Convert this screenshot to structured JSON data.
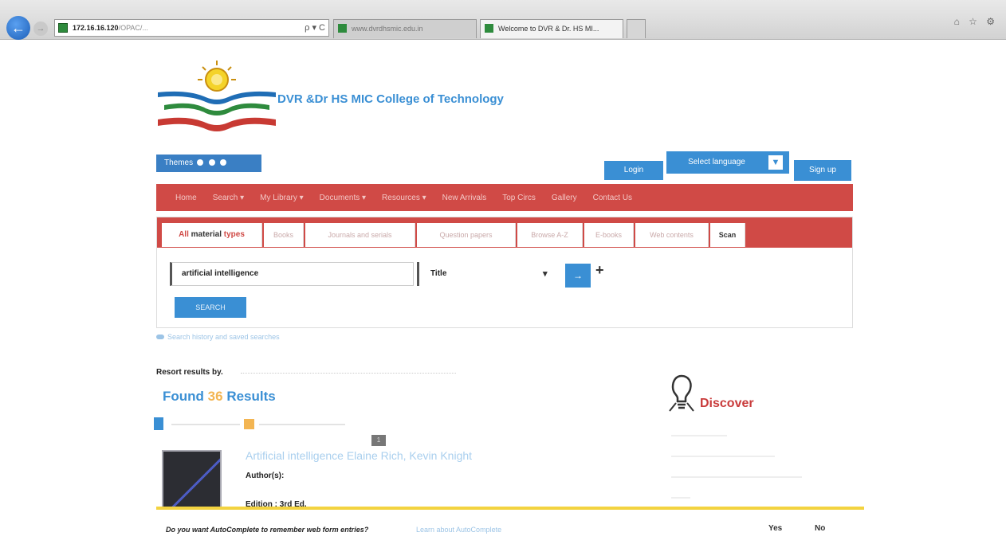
{
  "browser": {
    "address_host": "172.16.16.120",
    "address_path": "/OPAC/...",
    "address_tools": "ρ ▾ C",
    "tab_1_title": "www.dvrdhsmic.edu.in",
    "tab_2_title": "Welcome to DVR & Dr. HS MI...",
    "window_controls": "⌂ ☆ ⚙"
  },
  "header": {
    "college_name": "DVR &Dr HS MIC College of Technology",
    "theme_label": "Themes",
    "login_label": "Login",
    "language_label": "Select language",
    "signup_label": "Sign up"
  },
  "nav": {
    "items": [
      "Home",
      "Search ▾",
      "My Library ▾",
      "Documents ▾",
      "Resources ▾",
      "New Arrivals",
      "Top Circs",
      "Gallery",
      "Contact Us"
    ]
  },
  "search": {
    "tabs": [
      "All",
      "material",
      "types",
      "Books",
      "Journals and serials",
      "Question papers",
      "Browse A-Z",
      "E-books",
      "Web contents",
      "Scan"
    ],
    "query": "artificial intelligence",
    "field": "Title",
    "field_caret": "▾",
    "add_field_label": "+",
    "search_label": "SEARCH",
    "advanced_link": "Search history and saved searches"
  },
  "results": {
    "resort_label": "Resort results by.",
    "found_prefix": "Found",
    "found_count": "36",
    "found_suffix": "Results",
    "pager_label": "1",
    "first_title": "Artificial intelligence Elaine Rich, Kevin Knight",
    "author_label": "Author(s):",
    "edition_label": "Edition : 3rd Ed."
  },
  "discover": {
    "title": "Discover"
  },
  "autocomplete": {
    "question": "Do you want AutoComplete to remember web form entries?",
    "learn_link": "Learn about AutoComplete",
    "yes_label": "Yes",
    "no_label": "No"
  },
  "colors": {
    "accent_blue": "#3a8fd4",
    "nav_red": "#d04a46",
    "warning_yellow": "#f3d340"
  }
}
